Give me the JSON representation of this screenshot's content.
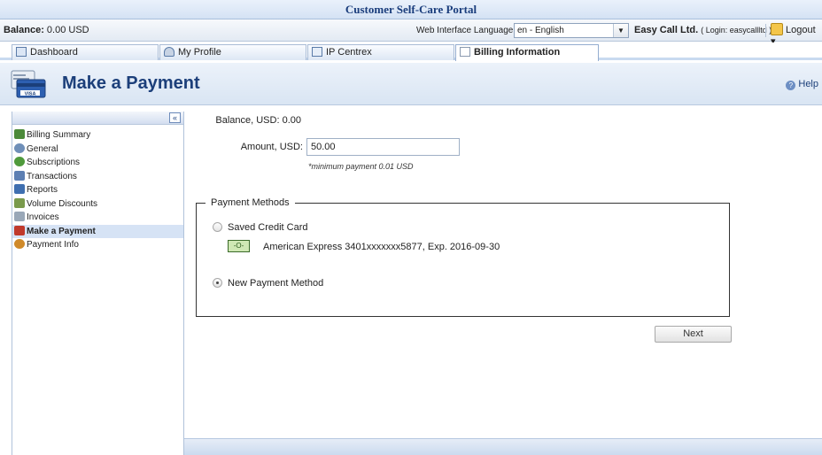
{
  "app": {
    "title": "Customer Self-Care Portal"
  },
  "topbar": {
    "balance_label": "Balance:",
    "balance_value": "0.00 USD",
    "language_label": "Web Interface Language:",
    "language_value": "en - English",
    "company": "Easy Call Ltd.",
    "login_text": "( Login: easycallltd )",
    "logout": "Logout"
  },
  "tabs": [
    {
      "label": "Dashboard",
      "icon": "dashboard-icon"
    },
    {
      "label": "My Profile",
      "icon": "user-icon"
    },
    {
      "label": "IP Centrex",
      "icon": "network-icon"
    },
    {
      "label": "Billing Information",
      "icon": "document-icon",
      "active": true
    }
  ],
  "page": {
    "title": "Make a Payment",
    "help": "Help",
    "icon": "credit-card-icon"
  },
  "sidebar": {
    "items": [
      {
        "label": "Billing Summary",
        "icon": "chart-icon",
        "color": "#4c8a3a"
      },
      {
        "label": "General",
        "icon": "gear-icon",
        "color": "#6f8fb8"
      },
      {
        "label": "Subscriptions",
        "icon": "refresh-icon",
        "color": "#4f9a3c"
      },
      {
        "label": "Transactions",
        "icon": "list-icon",
        "color": "#5c7fb3"
      },
      {
        "label": "Reports",
        "icon": "bar-chart-icon",
        "color": "#3f6fb0"
      },
      {
        "label": "Volume Discounts",
        "icon": "discount-icon",
        "color": "#7a9a4c"
      },
      {
        "label": "Invoices",
        "icon": "invoice-icon",
        "color": "#9aa8b8"
      },
      {
        "label": "Make a Payment",
        "icon": "payment-icon",
        "color": "#c0392b",
        "active": true
      },
      {
        "label": "Payment Info",
        "icon": "info-icon",
        "color": "#d08a2a"
      }
    ]
  },
  "form": {
    "balance_label": "Balance, USD:",
    "balance_value": "0.00",
    "amount_label": "Amount, USD:",
    "amount_value": "50.00",
    "min_note": "*minimum payment 0.01 USD",
    "methods_legend": "Payment Methods",
    "saved_card_label": "Saved Credit Card",
    "card_icon_text": "-O-",
    "card_text": "American Express 3401xxxxxxx5877, Exp. 2016-09-30",
    "new_method_label": "New Payment Method",
    "selected_method": "New Payment Method",
    "next_label": "Next"
  }
}
